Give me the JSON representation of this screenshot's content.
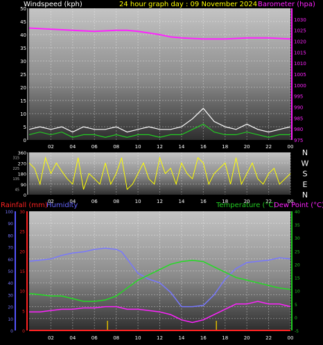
{
  "header": {
    "windspeed_label": "Windspeed (kph)",
    "title": "24 hour graph day : 09 November 2024",
    "barometer_label": "Barometer (hpa)",
    "rainfall_label": "Rainfall (mm)",
    "humidity_label": "Humidity",
    "temperature_label": "Temperature (°C)",
    "dewpoint_label": "Dew Point (°C)"
  },
  "colors": {
    "wind_avg": "#22cc22",
    "wind_gust": "#ffffff",
    "barometer": "#ff22ff",
    "direction": "#ffff00",
    "rainfall": "#ff2222",
    "humidity": "#7777ff",
    "temperature": "#22dd22",
    "dewpoint": "#ff22ff",
    "rain_marker": "#ddbb00",
    "label_yellow": "#ffff00",
    "label_red": "#ff2222",
    "label_blue": "#6666ff",
    "label_green": "#22cc22",
    "label_magenta": "#ff22ff"
  },
  "chart_data": [
    {
      "type": "line",
      "title": "24 hour graph day : 09 November 2024",
      "x_tick_labels": [
        "02",
        "04",
        "06",
        "08",
        "10",
        "12",
        "14",
        "16",
        "18",
        "20",
        "22",
        "00"
      ],
      "left_axis": {
        "label": "Windspeed (kph)",
        "ylim": [
          0,
          50
        ],
        "tick_labels": [
          "0",
          "5",
          "10",
          "15",
          "20",
          "25",
          "30",
          "35",
          "40",
          "45",
          "50"
        ]
      },
      "right_axis": {
        "label": "Barometer (hpa)",
        "ylim": [
          975,
          1035
        ],
        "tick_labels": [
          "975",
          "980",
          "985",
          "990",
          "995",
          "1000",
          "1005",
          "1010",
          "1015",
          "1020",
          "1025",
          "1030"
        ]
      },
      "grid": true,
      "series": [
        {
          "name": "Barometer (hpa)",
          "axis": "right",
          "x": [
            0,
            2,
            4,
            6,
            8,
            9,
            10,
            12,
            13,
            14,
            16,
            18,
            20,
            22,
            24
          ],
          "values": [
            1026,
            1025.5,
            1025,
            1024.5,
            1025,
            1025,
            1024.5,
            1023,
            1022,
            1021.5,
            1021,
            1021,
            1021.5,
            1021.5,
            1021
          ]
        },
        {
          "name": "Gust (kph)",
          "axis": "left",
          "x": [
            0,
            1,
            2,
            3,
            4,
            5,
            6,
            7,
            8,
            9,
            10,
            11,
            12,
            13,
            14,
            15,
            16,
            17,
            18,
            19,
            20,
            21,
            22,
            23,
            24
          ],
          "values": [
            4,
            5,
            4,
            5,
            3,
            5,
            4,
            4,
            5,
            3,
            4,
            5,
            4,
            4,
            5,
            8,
            12,
            7,
            5,
            4,
            6,
            4,
            3,
            4,
            5
          ]
        },
        {
          "name": "Average (kph)",
          "axis": "left",
          "x": [
            0,
            1,
            2,
            3,
            4,
            5,
            6,
            7,
            8,
            9,
            10,
            11,
            12,
            13,
            14,
            15,
            16,
            17,
            18,
            19,
            20,
            21,
            22,
            23,
            24
          ],
          "values": [
            2,
            3,
            2,
            3,
            1,
            2,
            2,
            1,
            2,
            1,
            2,
            2,
            1,
            2,
            2,
            4,
            6,
            3,
            2,
            2,
            3,
            2,
            1,
            2,
            2
          ]
        }
      ]
    },
    {
      "type": "scatter",
      "title": "",
      "x_tick_labels": [
        "02",
        "04",
        "06",
        "08",
        "10",
        "12",
        "14",
        "16",
        "18",
        "20",
        "22",
        "00"
      ],
      "left_axis": {
        "label": "",
        "ylim": [
          0,
          360
        ],
        "tick_labels": [
          "0",
          "90",
          "180",
          "270",
          "360"
        ],
        "extra_tick_labels": [
          "45",
          "135",
          "225",
          "315"
        ]
      },
      "right_labels": [
        "N",
        "W",
        "S",
        "E",
        "N"
      ],
      "grid": true,
      "series": [
        {
          "name": "Wind direction",
          "x": [
            0,
            0.5,
            1,
            1.5,
            2,
            2.5,
            3,
            3.5,
            4,
            4.5,
            5,
            5.5,
            6,
            6.5,
            7,
            7.5,
            8,
            8.5,
            9,
            9.5,
            10,
            10.5,
            11,
            11.5,
            12,
            12.5,
            13,
            13.5,
            14,
            14.5,
            15,
            15.5,
            16,
            16.5,
            17,
            17.5,
            18,
            18.5,
            19,
            19.5,
            20,
            20.5,
            21,
            21.5,
            22,
            22.5,
            23,
            23.5,
            24
          ],
          "values": [
            270,
            225,
            90,
            315,
            180,
            270,
            200,
            135,
            90,
            315,
            45,
            180,
            135,
            90,
            270,
            90,
            180,
            315,
            45,
            90,
            180,
            270,
            135,
            90,
            315,
            180,
            225,
            90,
            270,
            180,
            135,
            315,
            270,
            90,
            180,
            225,
            270,
            90,
            315,
            90,
            180,
            270,
            135,
            90,
            180,
            225,
            90,
            135,
            180
          ]
        }
      ]
    },
    {
      "type": "line",
      "title": "",
      "x_tick_labels": [
        "02",
        "04",
        "06",
        "08",
        "10",
        "12",
        "14",
        "16",
        "18",
        "20",
        "22",
        "00"
      ],
      "humidity_axis": {
        "ylim": [
          0,
          100
        ],
        "tick_labels": [
          "0",
          "10",
          "20",
          "30",
          "40",
          "50",
          "60",
          "70",
          "80",
          "90",
          "100"
        ]
      },
      "rainfall_axis": {
        "ylim": [
          0,
          30
        ],
        "tick_labels": [
          "0",
          "5",
          "10",
          "15",
          "20",
          "25",
          "30"
        ]
      },
      "temperature_axis": {
        "ylim": [
          -5,
          40
        ],
        "tick_labels": [
          "-5",
          "0",
          "5",
          "10",
          "15",
          "20",
          "25",
          "30",
          "35",
          "40"
        ]
      },
      "grid": true,
      "series": [
        {
          "name": "Humidity",
          "x": [
            0,
            1,
            2,
            3,
            4,
            5,
            6,
            7,
            8,
            8.5,
            9,
            10,
            11,
            12,
            13,
            14,
            15,
            16,
            17,
            18,
            19,
            20,
            21,
            22,
            23,
            24
          ],
          "values": [
            58,
            59,
            60,
            63,
            65,
            66,
            68,
            69,
            68,
            66,
            60,
            48,
            43,
            40,
            32,
            20,
            20,
            21,
            30,
            43,
            52,
            57,
            58,
            59,
            61,
            60
          ]
        },
        {
          "name": "Temperature (°C)",
          "x": [
            0,
            1,
            2,
            3,
            4,
            5,
            6,
            7,
            8,
            9,
            10,
            11,
            12,
            13,
            14,
            15,
            16,
            17,
            18,
            19,
            20,
            21,
            22,
            23,
            24
          ],
          "values": [
            9,
            8.5,
            8,
            8,
            7,
            6,
            6,
            6.5,
            8,
            11,
            14,
            16,
            18,
            20,
            21,
            21.5,
            21,
            19,
            17,
            15,
            14,
            13,
            12,
            11,
            10.5
          ]
        },
        {
          "name": "Dew Point (°C)",
          "x": [
            0,
            1,
            2,
            3,
            4,
            5,
            6,
            7,
            8,
            9,
            10,
            11,
            12,
            13,
            14,
            15,
            16,
            17,
            18,
            19,
            20,
            21,
            22,
            23,
            24
          ],
          "values": [
            2,
            2,
            2.5,
            3,
            3,
            3.5,
            3.5,
            4,
            4,
            3,
            3,
            2.5,
            2,
            1,
            -1,
            -2,
            -1,
            1,
            3,
            5,
            5,
            6,
            5,
            5,
            4
          ]
        },
        {
          "name": "Rainfall (mm)",
          "x": [
            0,
            24
          ],
          "values": [
            0,
            0
          ]
        }
      ],
      "rain_markers_x": [
        7.2,
        17.2
      ]
    }
  ]
}
